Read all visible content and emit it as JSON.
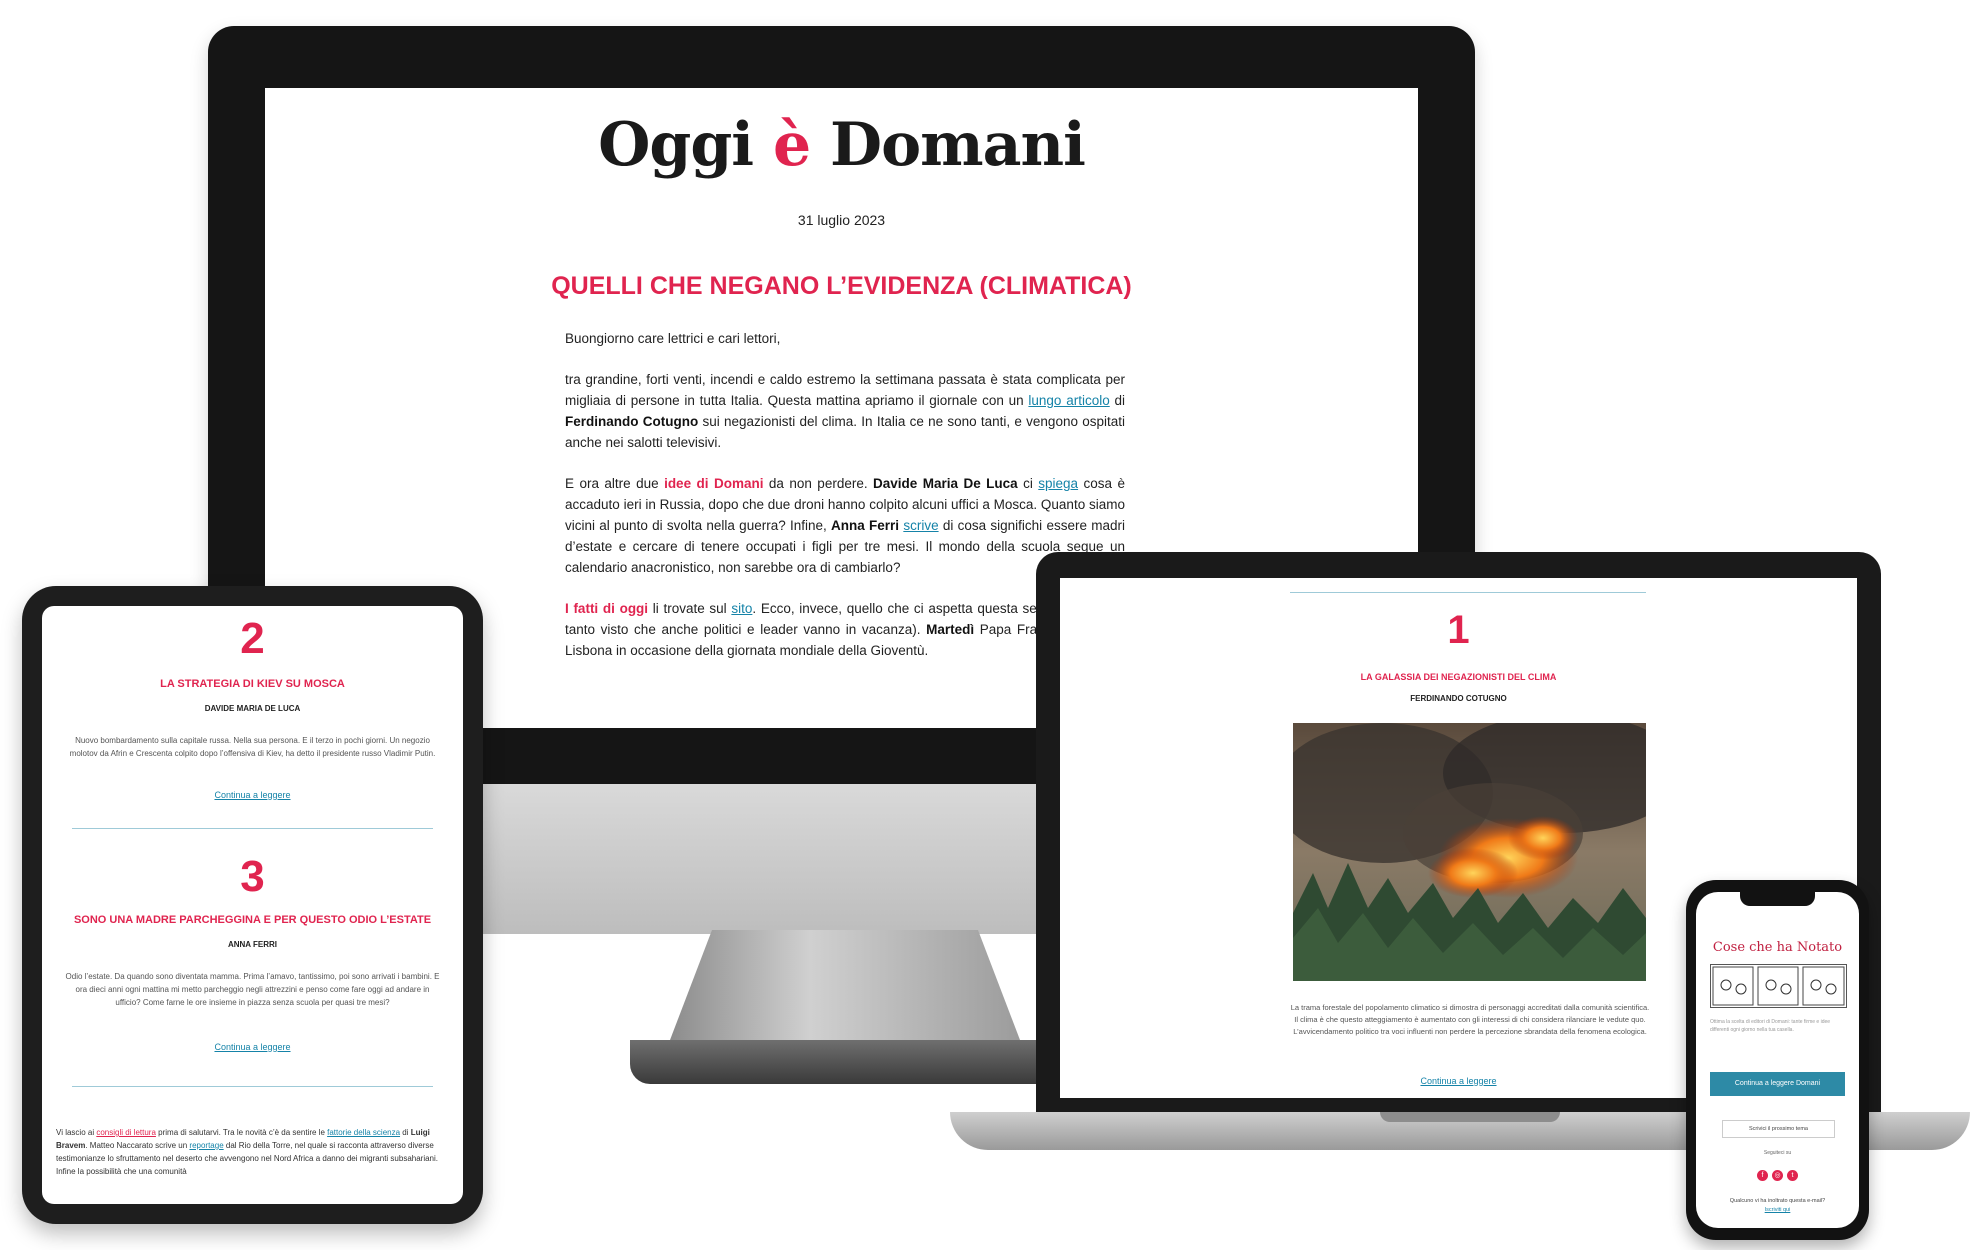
{
  "newsletter": {
    "logo_part1": "Oggi ",
    "logo_accent": "è",
    "logo_part2": " Domani",
    "date": "31 luglio 2023",
    "headline": "QUELLI CHE NEGANO L’EVIDENZA (CLIMATICA)",
    "greeting": "Buongiorno care lettrici e cari lettori,",
    "p1_a": "tra grandine, forti venti, incendi e caldo estremo la settimana passata è stata complicata per migliaia di persone in tutta Italia. Questa mattina apriamo il giornale con un ",
    "p1_link": "lungo articolo",
    "p1_b": " di ",
    "p1_author": "Ferdinando Cotugno",
    "p1_c": " sui negazionisti del clima. In Italia ce ne sono tanti, e vengono ospitati anche nei salotti televisivi.",
    "p2_a": "E ora altre due ",
    "p2_red": "idee di Domani",
    "p2_b": " da non perdere. ",
    "p2_author1": "Davide Maria De Luca",
    "p2_c": " ci ",
    "p2_link1": "spiega",
    "p2_d": " cosa è accaduto ieri in Russia, dopo che due droni hanno colpito alcuni uffici a Mosca. Quanto siamo vicini al punto di svolta nella guerra? Infine, ",
    "p2_author2": "Anna Ferri",
    "p2_e": " ",
    "p2_link2": "scrive",
    "p2_f": " di cosa significhi essere madri d’estate e cercare di tenere occupati i figli per tre mesi. Il mondo della scuola segue un calendario anacronistico, non sarebbe ora di cambiarlo?",
    "p3_red": "I fatti di oggi",
    "p3_a": " li trovate sul ",
    "p3_link": "sito",
    "p3_b": ". Ecco, invece, quello che ci aspetta questa settimana (non è tanto visto che anche politici e leader vanno in vacanza). ",
    "p3_bold": "Martedì",
    "p3_c": " Papa Francesco sarà a Lisbona in occasione della giornata mondiale della Gioventù."
  },
  "tablet": {
    "num2": "2",
    "title2": "LA STRATEGIA DI KIEV SU MOSCA",
    "author2": "DAVIDE MARIA DE LUCA",
    "text2": "Nuovo bombardamento sulla capitale russa. Nella sua persona. E il terzo in pochi giorni. Un negozio molotov da Afrin e Crescenta colpito dopo l’offensiva di Kiev, ha detto il presidente russo Vladimir Putin.",
    "link2": "Continua a leggere",
    "num3": "3",
    "title3": "SONO UNA MADRE PARCHEGGINA E PER QUESTO ODIO L’ESTATE",
    "author3": "ANNA FERRI",
    "text3": "Odio l’estate. Da quando sono diventata mamma. Prima l’amavo, tantissimo, poi sono arrivati i bambini. E ora dieci anni ogni mattina mi metto parcheggio negli attrezzini e penso come fare oggi ad andare in ufficio? Come farne le ore insieme in piazza senza scuola per quasi tre mesi?",
    "link3": "Continua a leggere",
    "foot_a": "Vi lascio ai ",
    "foot_red": "consigli di lettura",
    "foot_b": " prima di salutarvi. Tra le novità c’è da sentire le ",
    "foot_link1": "fattorie della scienza",
    "foot_c": " di ",
    "foot_author": "Luigi Bravem",
    "foot_d": ". Matteo Naccarato scrive un ",
    "foot_link2": "reportage",
    "foot_e": " dal Rio della Torre, nel quale si racconta attraverso diverse testimonianze lo sfruttamento nel deserto che avvengono nel Nord Africa a danno dei migranti subsahariani. Infine la possibilità che una comunità"
  },
  "laptop": {
    "num": "1",
    "title": "LA GALASSIA DEI NEGAZIONISTI DEL CLIMA",
    "author": "FERDINANDO COTUGNO",
    "caption": "La trama forestale del popolamento climatico si dimostra di personaggi accreditati dalla comunità scientifica. Il clima è che questo atteggiamento è aumentato con gli interessi di chi considera rilanciare le vedute quo. L’avvicendamento politico tra voci influenti non perdere la percezione sbrandata della fenomena ecologica.",
    "link": "Continua a leggere"
  },
  "phone": {
    "comic_title": "Cose che ha Notato",
    "text": "Ottima la scelta di editori di Domani: tante firme e idee differenti ogni giorno nella tua casella.",
    "button": "Continua a leggere Domani",
    "button2": "Scrivici il prossimo tema",
    "social_label": "Seguiteci su",
    "foot1": "Qualcuno vi ha inoltrato questa e-mail?",
    "foot2": "Iscriviti qui"
  },
  "colors": {
    "accent": "#e0244f",
    "link": "#1583a8"
  }
}
